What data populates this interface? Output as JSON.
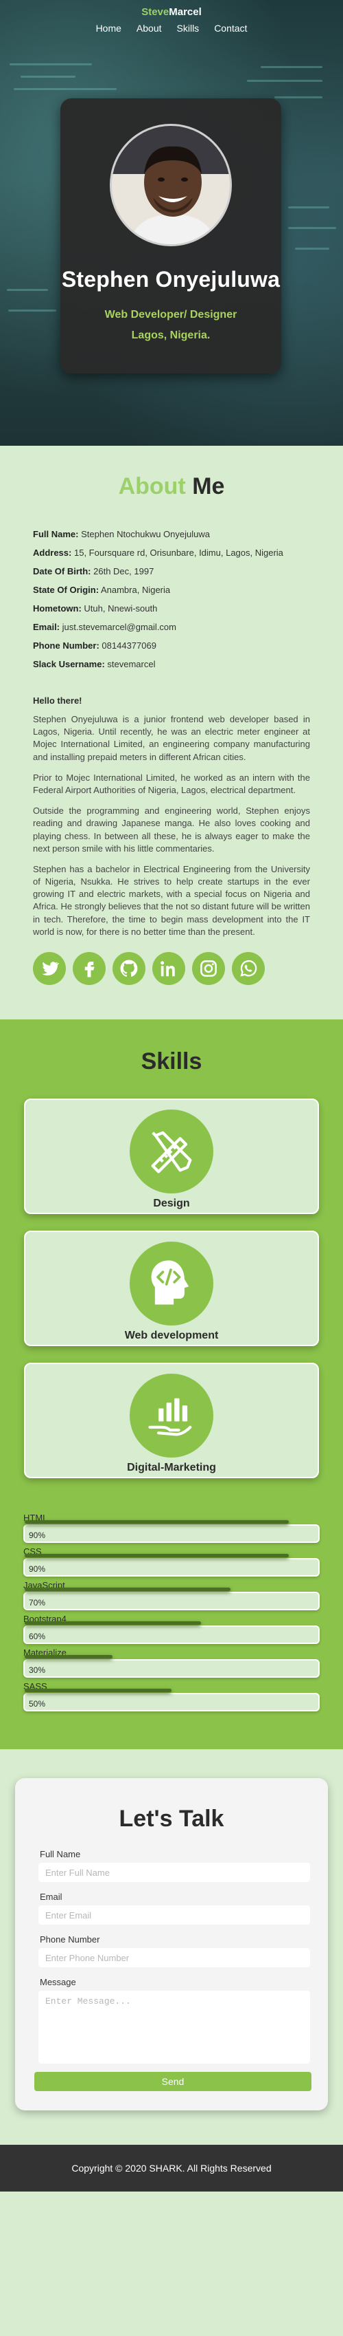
{
  "nav": {
    "brand_first": "Steve",
    "brand_second": "Marcel",
    "links": [
      "Home",
      "About",
      "Skills",
      "Contact"
    ]
  },
  "hero": {
    "name": "Stephen Onyejuluwa",
    "role": "Web Developer/ Designer",
    "location": "Lagos, Nigeria."
  },
  "about": {
    "title_first": "About",
    "title_second": " Me",
    "facts": [
      {
        "label": "Full Name:",
        "value": "Stephen Ntochukwu Onyejuluwa"
      },
      {
        "label": "Address:",
        "value": "15, Foursquare rd, Orisunbare, Idimu, Lagos, Nigeria"
      },
      {
        "label": "Date Of Birth:",
        "value": "26th Dec, 1997"
      },
      {
        "label": "State Of Origin:",
        "value": "Anambra, Nigeria"
      },
      {
        "label": "Hometown:",
        "value": "Utuh, Nnewi-south"
      },
      {
        "label": "Email:",
        "value": "just.stevemarcel@gmail.com"
      },
      {
        "label": "Phone Number:",
        "value": "08144377069"
      },
      {
        "label": "Slack Username:",
        "value": "stevemarcel"
      }
    ],
    "greeting": "Hello there!",
    "paragraphs": [
      "Stephen Onyejuluwa is a junior frontend web developer based in Lagos, Nigeria. Until recently, he was an electric meter engineer at Mojec International Limited, an engineering company manufacturing and installing prepaid meters in different African cities.",
      "Prior to Mojec International Limited, he worked as an intern with the Federal Airport Authorities of Nigeria, Lagos, electrical department.",
      "Outside the programming and engineering world, Stephen enjoys reading and drawing Japanese manga. He also loves cooking and playing chess. In between all these, he is always eager to make the next person smile with his little commentaries.",
      "Stephen has a bachelor in Electrical Engineering from the University of Nigeria, Nsukka. He strives to help create startups in the ever growing IT and electric markets, with a special focus on Nigeria and Africa. He strongly believes that the not so distant future will be written in tech. Therefore, the time to begin mass development into the IT world is now, for there is no better time than the present."
    ],
    "socials": [
      "twitter-icon",
      "facebook-icon",
      "github-icon",
      "linkedin-icon",
      "instagram-icon",
      "whatsapp-icon"
    ]
  },
  "skills": {
    "title": "Skills",
    "cards": [
      {
        "label": "Design",
        "icon": "pencil-ruler-icon"
      },
      {
        "label": "Web development",
        "icon": "head-code-icon"
      },
      {
        "label": "Digital-Marketing",
        "icon": "growth-hand-icon"
      }
    ],
    "bars": [
      {
        "name": "HTML",
        "percent": 90,
        "label": "90%"
      },
      {
        "name": "CSS",
        "percent": 90,
        "label": "90%"
      },
      {
        "name": "JavaScript",
        "percent": 70,
        "label": "70%"
      },
      {
        "name": "Bootstrap4",
        "percent": 60,
        "label": "60%"
      },
      {
        "name": "Materialize",
        "percent": 30,
        "label": "30%"
      },
      {
        "name": "SASS",
        "percent": 50,
        "label": "50%"
      }
    ]
  },
  "contact": {
    "title": "Let's Talk",
    "fields": {
      "name_label": "Full Name",
      "name_placeholder": "Enter Full Name",
      "email_label": "Email",
      "email_placeholder": "Enter Email",
      "phone_label": "Phone Number",
      "phone_placeholder": "Enter Phone Number",
      "message_label": "Message",
      "message_placeholder": "Enter Message..."
    },
    "send_label": "Send"
  },
  "footer": {
    "copyright": "Copyright © 2020 SHARK. All Rights Reserved"
  },
  "colors": {
    "accent": "#8bc34a",
    "accent_text": "#a8d35f",
    "page_bg": "#d8ecd0",
    "dark": "#2a2a2a",
    "footer": "#333333"
  }
}
